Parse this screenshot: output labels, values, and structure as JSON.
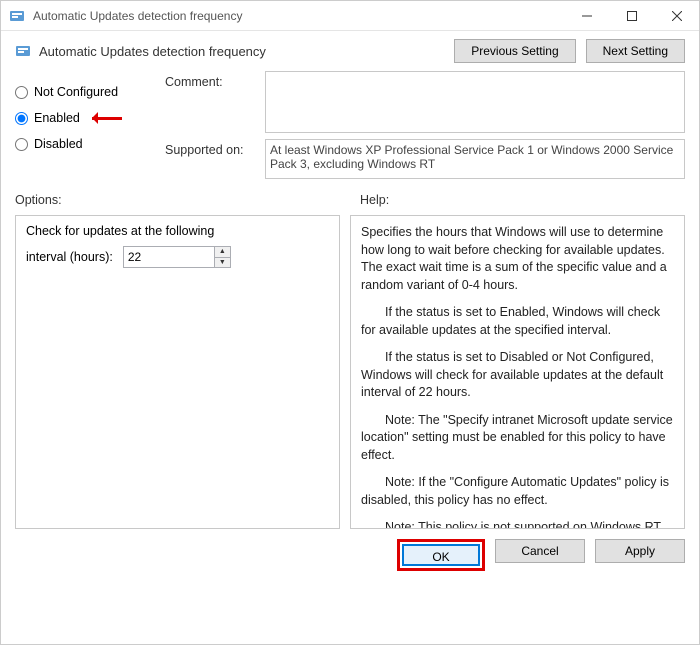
{
  "window": {
    "title": "Automatic Updates detection frequency"
  },
  "header": {
    "title": "Automatic Updates detection frequency",
    "prev_btn": "Previous Setting",
    "next_btn": "Next Setting"
  },
  "radios": {
    "not_configured": "Not Configured",
    "enabled": "Enabled",
    "disabled": "Disabled",
    "selected": "enabled"
  },
  "fields": {
    "comment_label": "Comment:",
    "comment_value": "",
    "supported_label": "Supported on:",
    "supported_value": "At least Windows XP Professional Service Pack 1 or Windows 2000 Service Pack 3, excluding Windows RT"
  },
  "labels": {
    "options": "Options:",
    "help": "Help:"
  },
  "options": {
    "line1": "Check for updates at the following",
    "interval_label": "interval (hours):",
    "interval_value": "22"
  },
  "help": {
    "p1": "Specifies the hours that Windows will use to determine how long to wait before checking for available updates. The exact wait time is a sum of the specific value and a random variant of 0-4 hours.",
    "p2": "If the status is set to Enabled, Windows will check for available updates at the specified interval.",
    "p3": "If the status is set to Disabled or Not Configured, Windows will check for available updates at the default interval of 22 hours.",
    "p4": "Note: The \"Specify intranet Microsoft update service location\" setting must be enabled for this policy to have effect.",
    "p5": "Note: If the \"Configure Automatic Updates\" policy is disabled, this policy has no effect.",
    "p6": "Note: This policy is not supported on Windows RT. Setting this policy will not have any effect on Windows RT PCs."
  },
  "footer": {
    "ok": "OK",
    "cancel": "Cancel",
    "apply": "Apply"
  }
}
